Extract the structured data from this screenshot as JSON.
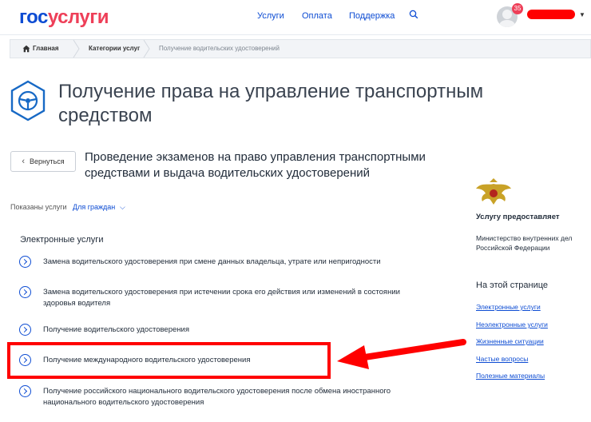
{
  "header": {
    "logo_part1": "гос",
    "logo_part2": "услуги",
    "nav": [
      "Услуги",
      "Оплата",
      "Поддержка"
    ],
    "notification_count": "35"
  },
  "breadcrumb": {
    "items": [
      "Главная",
      "Категории услуг",
      "Получение водительских удостоверений"
    ]
  },
  "page": {
    "title": "Получение права на управление транспортным средством",
    "back_label": "Вернуться",
    "subtitle": "Проведение экзаменов на право управления транспортными средствами и выдача водительских удостоверений"
  },
  "filter": {
    "label": "Показаны услуги",
    "value": "Для граждан"
  },
  "section": {
    "heading": "Электронные услуги",
    "services": [
      "Замена водительского удостоверения при смене данных владельца, утрате или непригодности",
      "Замена водительского удостоверения при истечении срока его действия или изменений в состоянии здоровья водителя",
      "Получение водительского удостоверения",
      "Получение международного водительского удостоверения",
      "Получение российского национального водительского удостоверения после обмена иностранного национального водительского удостоверения"
    ]
  },
  "sidebar": {
    "provider_heading": "Услугу предоставляет",
    "provider_name": "Министерство внутренних дел Российской Федерации",
    "onpage_heading": "На этой странице",
    "links": [
      "Электронные услуги",
      "Неэлектронные услуги",
      "Жизненные ситуации",
      "Частые вопросы",
      "Полезные материалы"
    ]
  },
  "colors": {
    "brand_blue": "#0d4cd3",
    "brand_red": "#ee3f58",
    "annotation_red": "#ff0000"
  }
}
